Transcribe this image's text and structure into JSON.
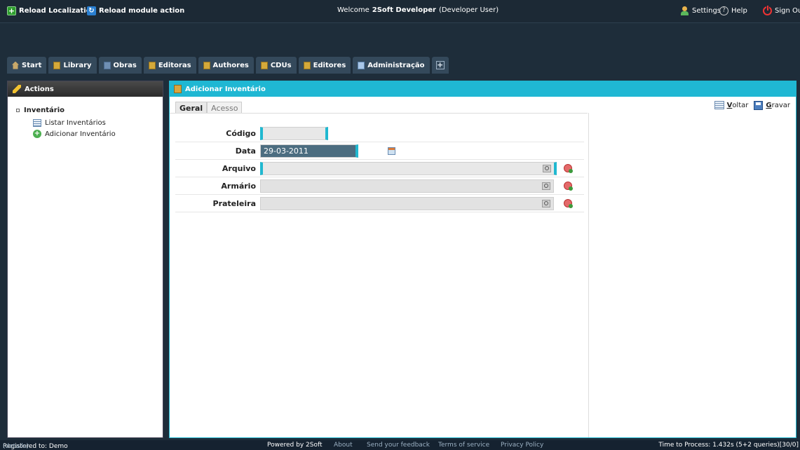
{
  "topbar": {
    "reload_localization": "Reload Localization",
    "reload_module": "Reload module action",
    "welcome_prefix": "Welcome",
    "user_name": "2Soft Developer",
    "user_role": "(Developer User)",
    "settings": "Settings",
    "help": "Help",
    "sign_out": "Sign Out"
  },
  "nav": {
    "tabs": [
      {
        "label": "Start",
        "icon": "home-icon"
      },
      {
        "label": "Library",
        "icon": "book-icon"
      },
      {
        "label": "Obras",
        "icon": "books-icon"
      },
      {
        "label": "Editoras",
        "icon": "book-icon"
      },
      {
        "label": "Authores",
        "icon": "book-icon"
      },
      {
        "label": "CDUs",
        "icon": "book-icon"
      },
      {
        "label": "Editores",
        "icon": "book-icon"
      },
      {
        "label": "Administração",
        "icon": "monitor-icon"
      }
    ],
    "add_tab": "+"
  },
  "actions": {
    "title": "Actions",
    "root": "Inventário",
    "items": [
      "Listar Inventários",
      "Adicionar Inventário"
    ]
  },
  "main": {
    "title": "Adicionar Inventário",
    "tabs": [
      "Geral",
      "Acesso"
    ],
    "voltar_key": "V",
    "voltar_rest": "oltar",
    "gravar_key": "G",
    "gravar_rest": "ravar",
    "fields": {
      "codigo_label": "Código",
      "codigo_value": "",
      "data_label": "Data",
      "data_value": "29-03-2011",
      "arquivo_label": "Arquivo",
      "armario_label": "Armário",
      "prateleira_label": "Prateleira"
    }
  },
  "footer": {
    "registered": "Registered to: Demo",
    "details": "(details)",
    "powered": "Powered by 2Soft",
    "about": "About",
    "feedback": "Send your feedback",
    "terms": "Terms of service",
    "privacy": "Privacy Policy",
    "time": "Time to Process: 1.432s (5+2 queries)[30/0]"
  },
  "colors": {
    "accent": "#1fb7d3",
    "header_bg": "#1c2935"
  }
}
